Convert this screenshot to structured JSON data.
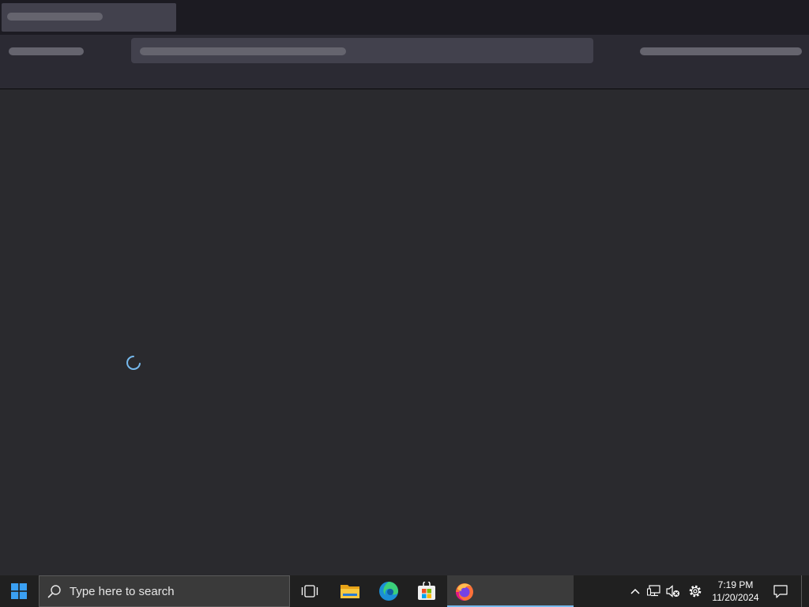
{
  "taskbar": {
    "search_placeholder": "Type here to search",
    "clock_time": "7:19 PM",
    "clock_date": "11/20/2024"
  },
  "colors": {
    "accent": "#76b9ed",
    "taskbar_bg": "#202020",
    "content_bg": "#2a2a2e"
  },
  "icons": {
    "start": "windows-logo-icon",
    "search": "search-icon",
    "taskview": "task-view-icon",
    "explorer": "folder-icon",
    "edge": "edge-icon",
    "store": "store-icon",
    "firefox": "firefox-icon",
    "chevron": "chevron-up-icon",
    "network": "network-icon",
    "volume": "volume-muted-icon",
    "settings": "gear-icon",
    "notifications": "notification-icon",
    "spinner": "loading-spinner-icon"
  }
}
